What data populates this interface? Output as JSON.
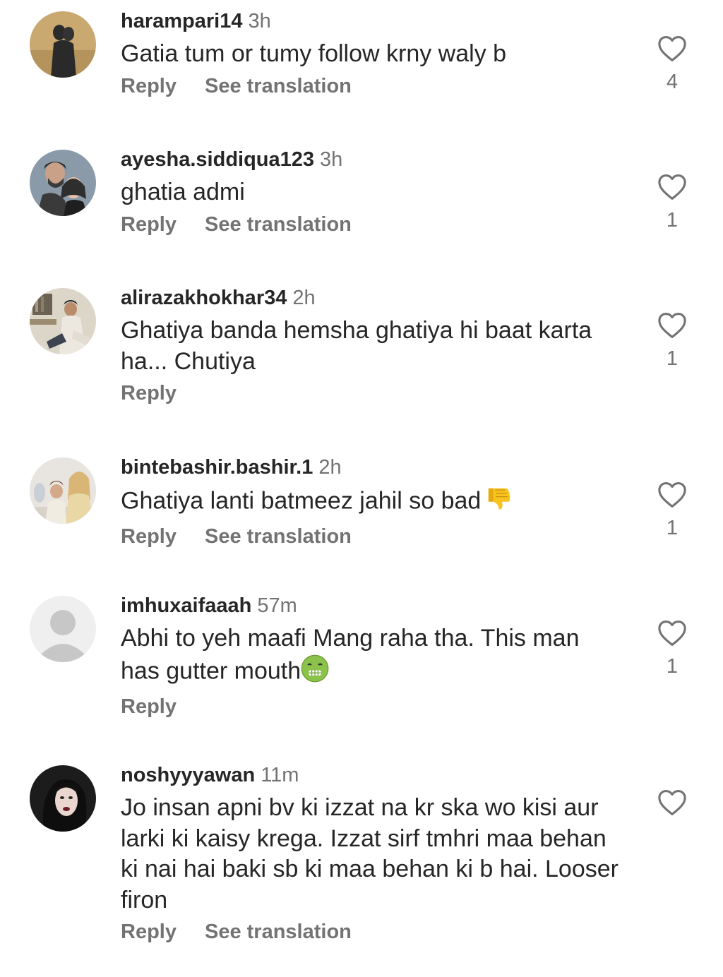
{
  "labels": {
    "reply": "Reply",
    "see_translation": "See translation"
  },
  "icons": {
    "like": "heart-outline-icon",
    "thumbs_down": "thumbs-down-emoji",
    "nauseated": "nauseated-face-emoji",
    "default_avatar": "person-icon"
  },
  "colors": {
    "text": "#262626",
    "secondary": "#737373",
    "emoji_yellow": "#f7c41f",
    "nauseated_green": "#8bc34a"
  },
  "comments": [
    {
      "username": "harampari14",
      "time": "3h",
      "text": "Gatia tum or tumy follow krny waly b",
      "likes": "4",
      "reply": "Reply",
      "translation": "See translation"
    },
    {
      "username": "ayesha.siddiqua123",
      "time": "3h",
      "text": "ghatia admi",
      "likes": "1",
      "reply": "Reply",
      "translation": "See translation"
    },
    {
      "username": "alirazakhokhar34",
      "time": "2h",
      "text": "Ghatiya banda hemsha ghatiya hi baat karta ha... Chutiya",
      "likes": "1",
      "reply": "Reply"
    },
    {
      "username": "bintebashir.bashir.1",
      "time": "2h",
      "text": "Ghatiya lanti batmeez jahil so bad",
      "likes": "1",
      "reply": "Reply",
      "translation": "See translation"
    },
    {
      "username": "imhuxaifaaah",
      "time": "57m",
      "text": "Abhi to yeh maafi Mang raha tha. This man has gutter mouth",
      "likes": "1",
      "reply": "Reply"
    },
    {
      "username": "noshyyyawan",
      "time": "11m",
      "text": "Jo insan apni bv ki izzat na kr ska wo kisi aur larki ki kaisy krega. Izzat sirf tmhri maa behan ki nai hai baki sb ki maa behan ki b hai. Looser firon",
      "reply": "Reply",
      "translation": "See translation"
    }
  ]
}
